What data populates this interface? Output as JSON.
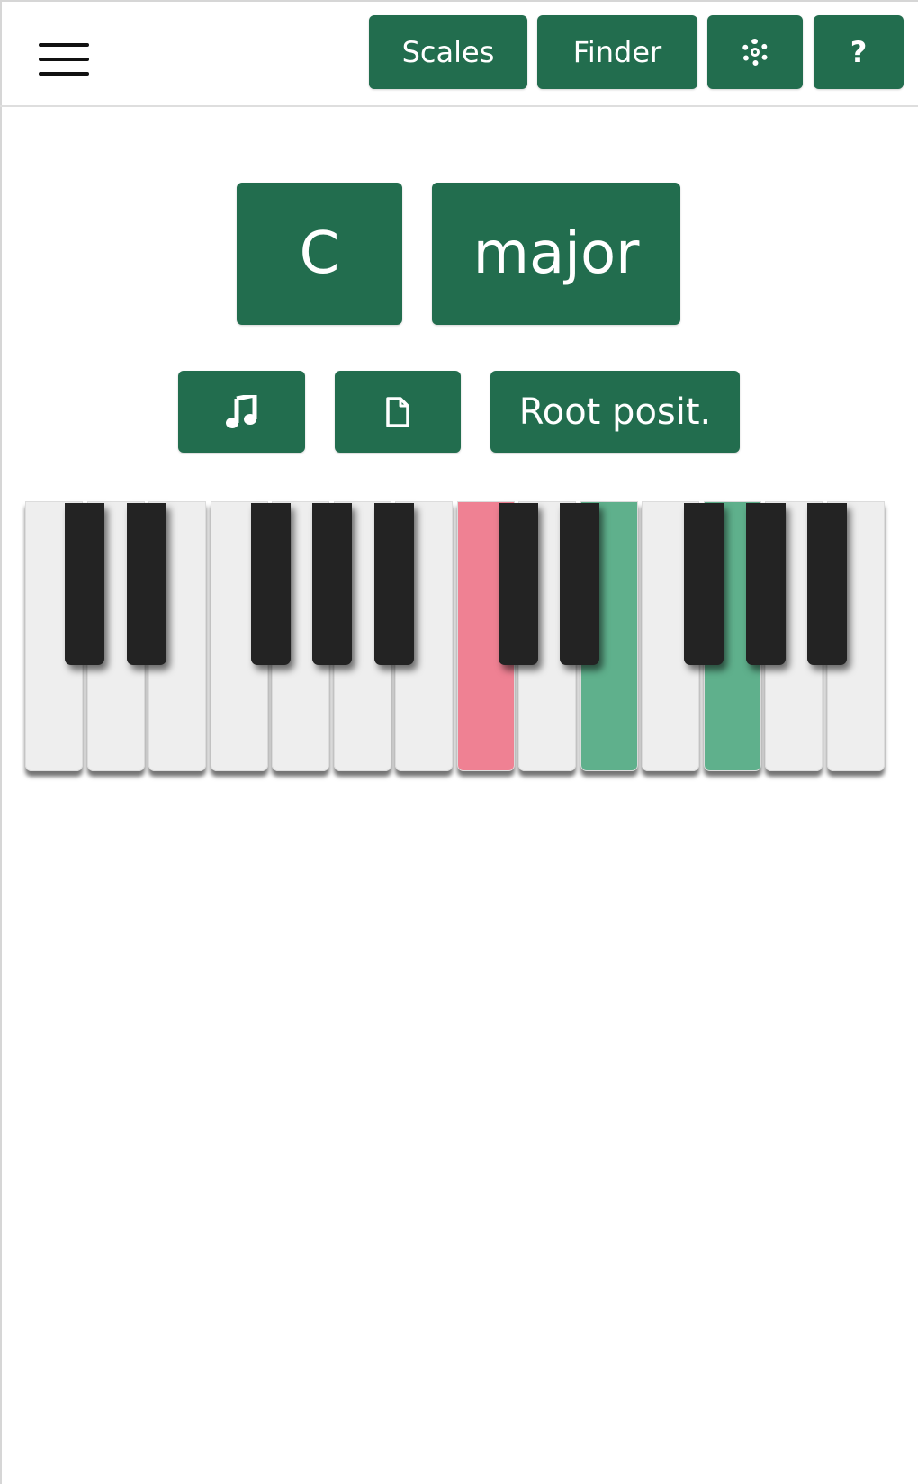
{
  "navbar": {
    "menu_icon": "hamburger-menu-icon",
    "scales_label": "Scales",
    "finder_label": "Finder",
    "settings_icon": "gear-icon",
    "help_label": "?"
  },
  "chord": {
    "root_label": "C",
    "type_label": "major"
  },
  "options": {
    "play_icon": "music-note-icon",
    "sheet_icon": "document-icon",
    "inversion_label": "Root posit."
  },
  "piano": {
    "white_keys": 14,
    "black_keys": 10,
    "highlighted": [
      {
        "key": "white-8",
        "role": "root",
        "color": "#ef8193"
      },
      {
        "key": "white-10",
        "role": "chord-tone",
        "color": "#5fb08c"
      },
      {
        "key": "white-12",
        "role": "chord-tone",
        "color": "#5fb08c"
      }
    ]
  },
  "colors": {
    "accent": "#226d4e",
    "root": "#ef8193",
    "chord_tone": "#5fb08c"
  }
}
